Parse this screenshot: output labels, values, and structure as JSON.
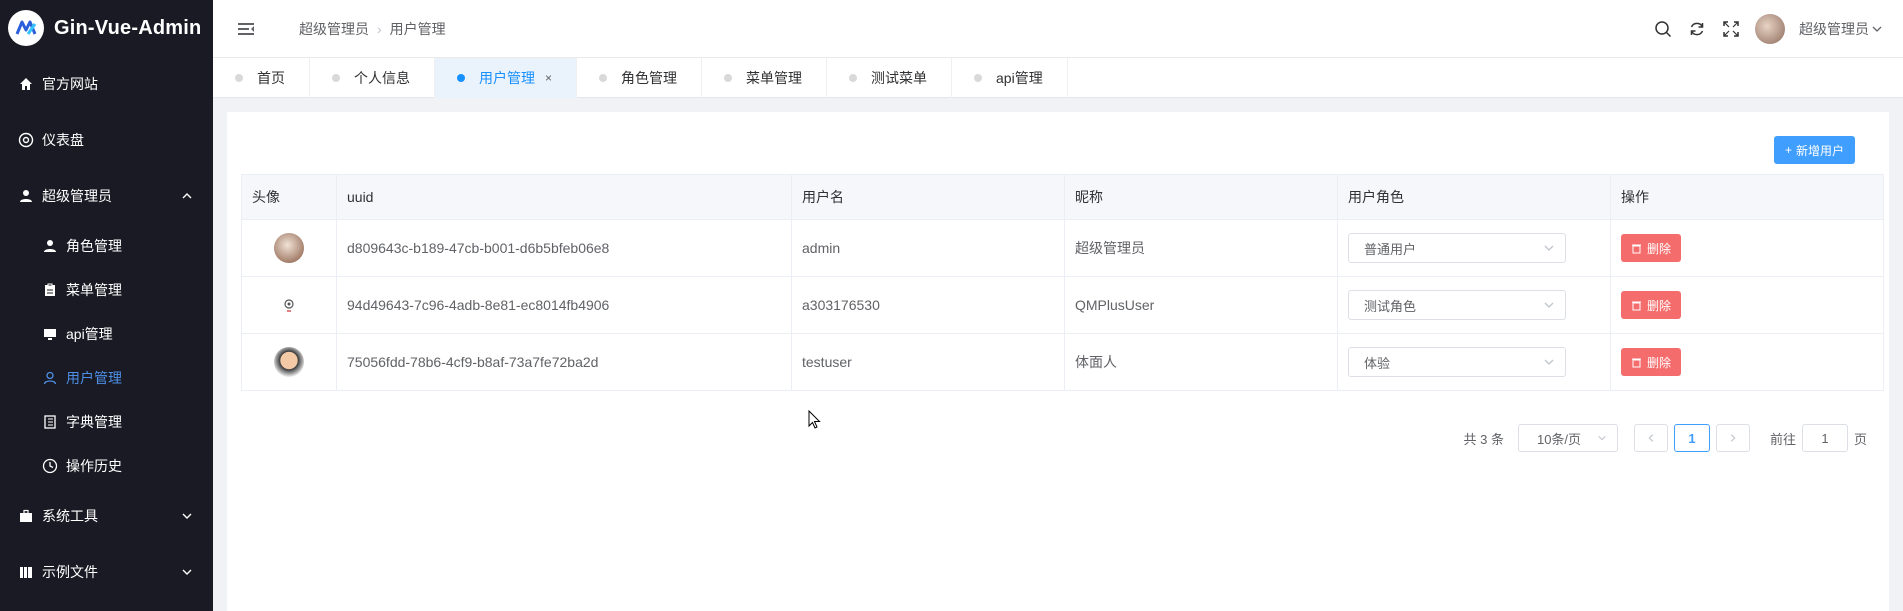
{
  "app": {
    "title": "Gin-Vue-Admin"
  },
  "sidebar": {
    "items": [
      {
        "label": "官方网站",
        "icon": "home-icon"
      },
      {
        "label": "仪表盘",
        "icon": "dashboard-icon"
      },
      {
        "label": "超级管理员",
        "icon": "user-icon",
        "expanded": true
      },
      {
        "label": "系统工具",
        "icon": "toolbox-icon"
      },
      {
        "label": "示例文件",
        "icon": "files-icon"
      }
    ],
    "submenu": [
      {
        "label": "角色管理",
        "icon": "user-icon"
      },
      {
        "label": "菜单管理",
        "icon": "clipboard-icon"
      },
      {
        "label": "api管理",
        "icon": "monitor-icon"
      },
      {
        "label": "用户管理",
        "icon": "user-outline-icon",
        "active": true
      },
      {
        "label": "字典管理",
        "icon": "book-icon"
      },
      {
        "label": "操作历史",
        "icon": "clock-icon"
      }
    ]
  },
  "header": {
    "breadcrumb": [
      "超级管理员",
      "用户管理"
    ],
    "user_name": "超级管理员"
  },
  "tabs": [
    {
      "label": "首页"
    },
    {
      "label": "个人信息"
    },
    {
      "label": "用户管理",
      "active": true,
      "close": "×"
    },
    {
      "label": "角色管理"
    },
    {
      "label": "菜单管理"
    },
    {
      "label": "测试菜单"
    },
    {
      "label": "api管理"
    }
  ],
  "toolbar": {
    "add_label": "新增用户"
  },
  "table": {
    "columns": [
      "头像",
      "uuid",
      "用户名",
      "昵称",
      "用户角色",
      "操作"
    ],
    "rows": [
      {
        "uuid": "d809643c-b189-47cb-b001-d6b5bfeb06e8",
        "username": "admin",
        "nickname": "超级管理员",
        "role": "普通用户",
        "action": "删除"
      },
      {
        "uuid": "94d49643-7c96-4adb-8e81-ec8014fb4906",
        "username": "a303176530",
        "nickname": "QMPlusUser",
        "role": "测试角色",
        "action": "删除"
      },
      {
        "uuid": "75056fdd-78b6-4cf9-b8af-73a7fe72ba2d",
        "username": "testuser",
        "nickname": "体面人",
        "role": "体验",
        "action": "删除"
      }
    ]
  },
  "pagination": {
    "total": "共 3 条",
    "page_size": "10条/页",
    "current_page": "1",
    "goto_prefix": "前往",
    "goto_value": "1",
    "goto_suffix": "页"
  },
  "colors": {
    "sidebar_bg": "#191a23",
    "primary": "#409eff",
    "danger": "#f56c6c",
    "active_link": "#4d8fe6"
  }
}
